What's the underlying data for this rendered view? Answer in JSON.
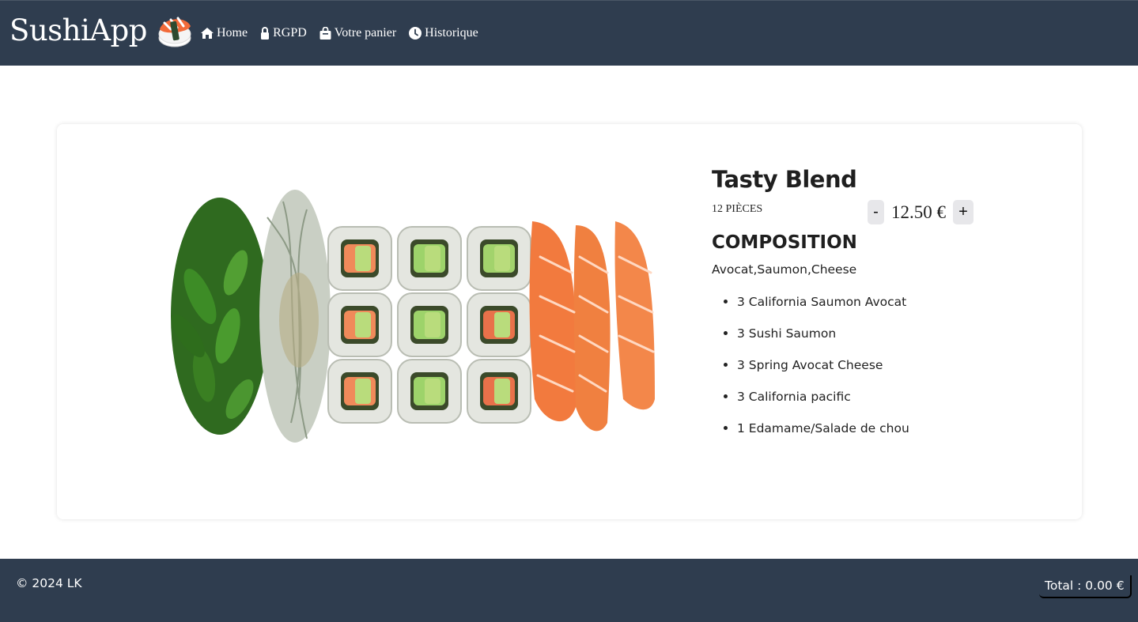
{
  "header": {
    "brand": "SushiApp",
    "nav": [
      {
        "label": "Home",
        "icon": "home-icon"
      },
      {
        "label": "RGPD",
        "icon": "lock-icon"
      },
      {
        "label": "Votre panier",
        "icon": "shopping-bag-icon"
      },
      {
        "label": "Historique",
        "icon": "clock-icon"
      }
    ]
  },
  "product": {
    "name": "Tasty Blend",
    "pieces": "12 PIÈCES",
    "price": "12.50 €",
    "minus_label": "-",
    "plus_label": "+",
    "composition_title": "COMPOSITION",
    "composition_summary": "Avocat,Saumon,Cheese",
    "items": [
      "3 California Saumon Avocat",
      "3 Sushi Saumon",
      "3 Spring Avocat Cheese",
      "3 California pacific",
      "1 Edamame/Salade de chou"
    ]
  },
  "footer": {
    "copyright": "© 2024 LK",
    "total": "Total : 0.00 €"
  },
  "colors": {
    "header_bg": "#2f3d4f",
    "footer_bg": "#2f3d4f",
    "qty_button_bg": "#e7e7ea"
  }
}
